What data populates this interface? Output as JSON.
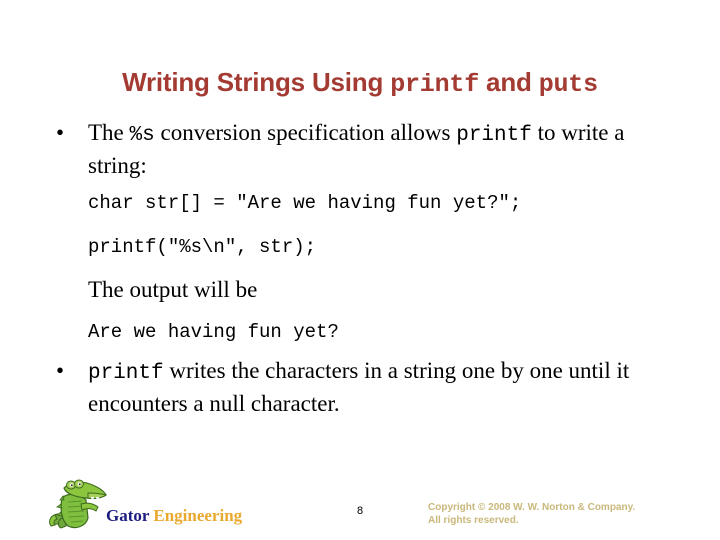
{
  "slide": {
    "title_parts": [
      {
        "text": "Writing Strings Using ",
        "style": "sans"
      },
      {
        "text": "printf",
        "style": "mono"
      },
      {
        "text": " and ",
        "style": "sans"
      },
      {
        "text": "puts",
        "style": "mono"
      }
    ],
    "title_plain": "Writing Strings Using printf and puts",
    "title_color": "#A33B33",
    "bullet_glyph": "•",
    "bullet1": {
      "seg1": "The ",
      "code1": "%s",
      "seg2": " conversion specification allows ",
      "code2": "printf",
      "seg3": " to write a string:"
    },
    "code_line_1": "char str[] = \"Are we having fun yet?\";",
    "code_line_2": "printf(\"%s\\n\", str);",
    "output_label": "The output will be",
    "output_text": "Are we having fun yet?",
    "bullet2": {
      "code1": "printf",
      "seg1": " writes the characters in a string one by one until it encounters a null character."
    }
  },
  "footer": {
    "logo_gator": "Gator",
    "logo_engineering": " Engineering",
    "logo_gator_color": "#1B1B80",
    "logo_engineering_color": "#E9A92E",
    "page_number": "8",
    "copyright_line_1": "Copyright © 2008 W. W. Norton & Company.",
    "copyright_line_2": "All rights reserved.",
    "copyright_color": "#C9B87B"
  }
}
